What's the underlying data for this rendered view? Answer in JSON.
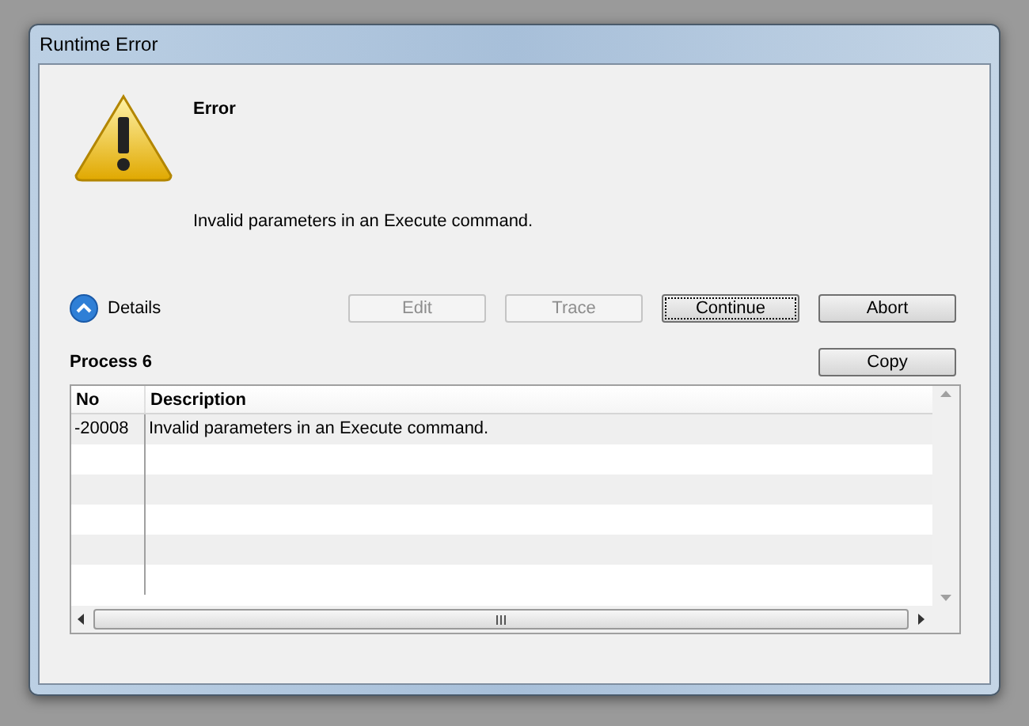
{
  "window": {
    "title": "Runtime Error"
  },
  "message": {
    "heading": "Error",
    "text": "Invalid parameters in an Execute command."
  },
  "details": {
    "label": "Details",
    "expanded": true
  },
  "buttons": [
    {
      "label": "Edit",
      "disabled": true,
      "default": false
    },
    {
      "label": "Trace",
      "disabled": true,
      "default": false
    },
    {
      "label": "Continue",
      "disabled": false,
      "default": true
    },
    {
      "label": "Abort",
      "disabled": false,
      "default": false
    }
  ],
  "process": {
    "title": "Process 6",
    "copy_button": "Copy"
  },
  "table": {
    "columns": [
      "No",
      "Description"
    ],
    "rows": [
      {
        "no": "-20008",
        "description": "Invalid parameters in an Execute command."
      }
    ]
  }
}
